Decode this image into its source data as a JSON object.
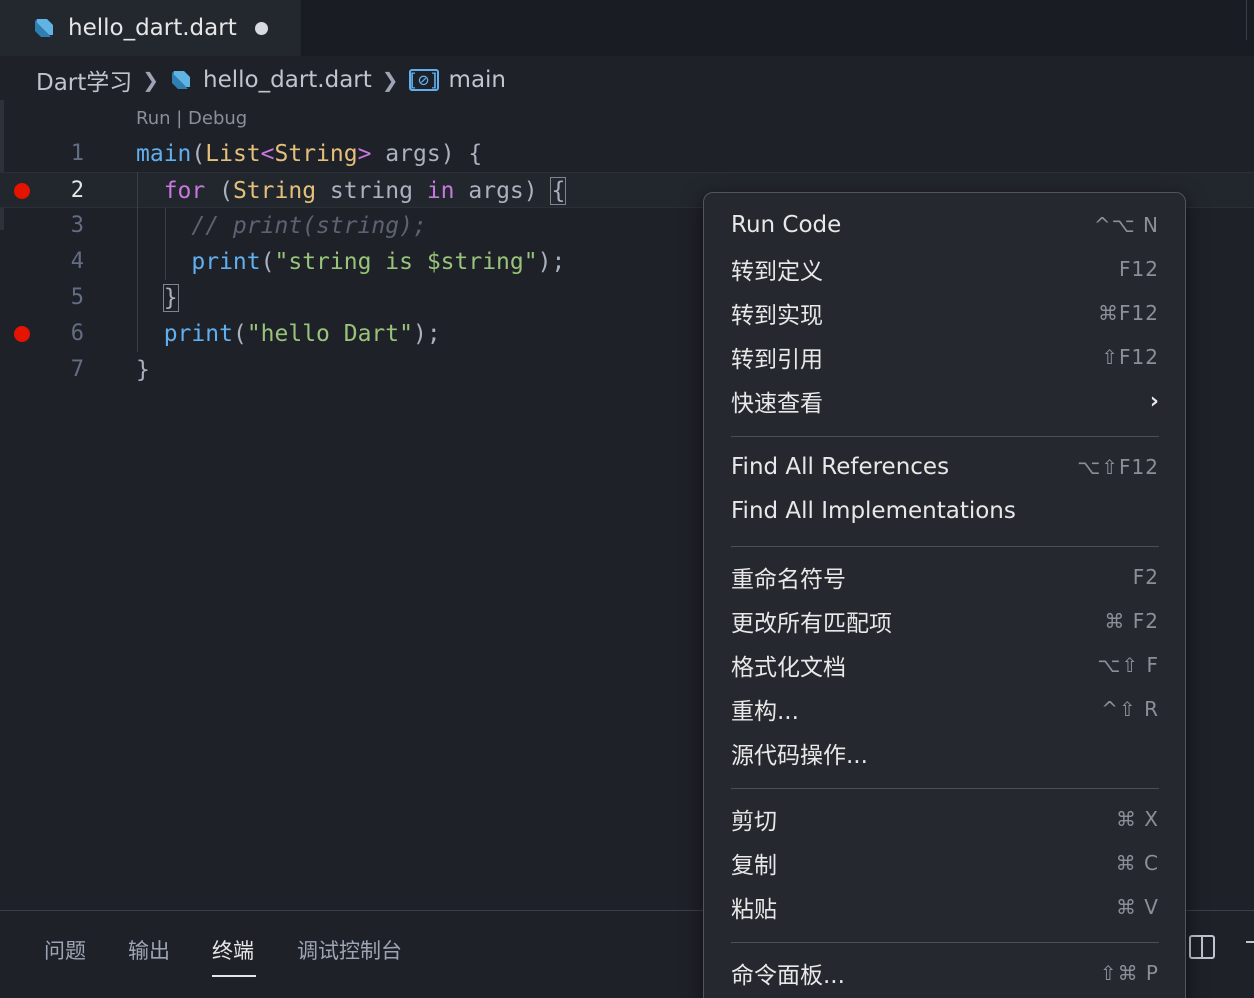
{
  "tab": {
    "label": "hello_dart.dart"
  },
  "breadcrumb": {
    "folder": "Dart学习",
    "file": "hello_dart.dart",
    "symbol_icon": "[⊘]",
    "symbol": "main"
  },
  "editor": {
    "codelens": "Run | Debug",
    "line_numbers": [
      "1",
      "2",
      "3",
      "4",
      "5",
      "6",
      "7"
    ],
    "lines": [
      {
        "parts": [
          {
            "t": "main",
            "c": "fn"
          },
          {
            "t": "(",
            "c": ""
          },
          {
            "t": "List",
            "c": "ty"
          },
          {
            "t": "<",
            "c": "kw"
          },
          {
            "t": "String",
            "c": "ty"
          },
          {
            "t": ">",
            "c": "kw"
          },
          {
            "t": " args) {",
            "c": ""
          }
        ]
      },
      {
        "parts": [
          {
            "t": "  for",
            "c": "kw"
          },
          {
            "t": " (",
            "c": ""
          },
          {
            "t": "String",
            "c": "ty"
          },
          {
            "t": " string ",
            "c": ""
          },
          {
            "t": "in",
            "c": "kw"
          },
          {
            "t": " args) ",
            "c": ""
          },
          {
            "t": "{",
            "c": "br"
          }
        ]
      },
      {
        "parts": [
          {
            "t": "    // print(string);",
            "c": "cm"
          }
        ]
      },
      {
        "parts": [
          {
            "t": "    ",
            "c": ""
          },
          {
            "t": "print",
            "c": "fn"
          },
          {
            "t": "(",
            "c": ""
          },
          {
            "t": "\"string is $string\"",
            "c": "str"
          },
          {
            "t": ");",
            "c": ""
          }
        ]
      },
      {
        "parts": [
          {
            "t": "  ",
            "c": ""
          },
          {
            "t": "}",
            "c": "br"
          }
        ]
      },
      {
        "parts": [
          {
            "t": "  ",
            "c": ""
          },
          {
            "t": "print",
            "c": "fn"
          },
          {
            "t": "(",
            "c": ""
          },
          {
            "t": "\"hello Dart\"",
            "c": "str"
          },
          {
            "t": ");",
            "c": ""
          }
        ]
      },
      {
        "parts": [
          {
            "t": "}",
            "c": ""
          }
        ]
      }
    ],
    "breakpoint_lines": [
      2,
      6
    ],
    "current_line": 2
  },
  "panel": {
    "tabs": [
      "问题",
      "输出",
      "终端",
      "调试控制台"
    ],
    "active_tab": "终端"
  },
  "menu": {
    "groups": [
      [
        {
          "label": "Run Code",
          "key": "^⌥ N"
        },
        {
          "label": "转到定义",
          "key": "F12"
        },
        {
          "label": "转到实现",
          "key": "⌘F12"
        },
        {
          "label": "转到引用",
          "key": "⇧F12"
        },
        {
          "label": "快速查看",
          "key": "",
          "submenu": "›"
        }
      ],
      [
        {
          "label": "Find All References",
          "key": "⌥⇧F12"
        },
        {
          "label": "Find All Implementations",
          "key": ""
        }
      ],
      [
        {
          "label": "重命名符号",
          "key": "F2"
        },
        {
          "label": "更改所有匹配项",
          "key": "⌘ F2"
        },
        {
          "label": "格式化文档",
          "key": "⌥⇧ F"
        },
        {
          "label": "重构...",
          "key": "^⇧ R"
        },
        {
          "label": "源代码操作...",
          "key": ""
        }
      ],
      [
        {
          "label": "剪切",
          "key": "⌘ X"
        },
        {
          "label": "复制",
          "key": "⌘ C"
        },
        {
          "label": "粘贴",
          "key": "⌘ V"
        }
      ],
      [
        {
          "label": "命令面板...",
          "key": "⇧⌘ P"
        }
      ]
    ]
  }
}
